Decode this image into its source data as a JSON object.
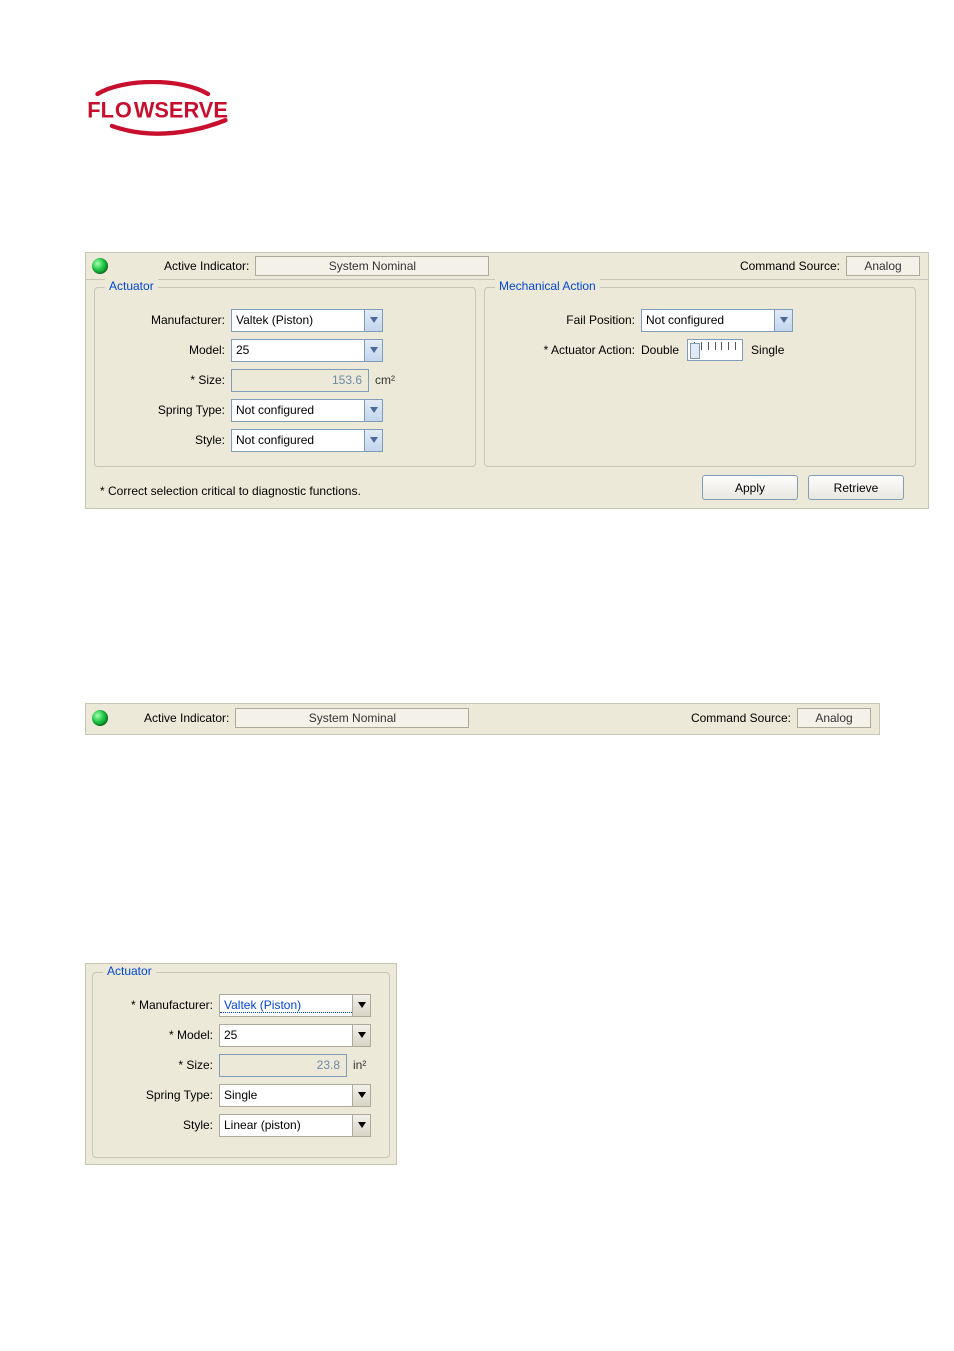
{
  "logo_text": "FLOWSERVE",
  "panel1": {
    "status": {
      "active_indicator_label": "Active Indicator:",
      "active_indicator_value": "System Nominal",
      "command_source_label": "Command Source:",
      "command_source_value": "Analog"
    },
    "actuator": {
      "legend": "Actuator",
      "manufacturer_label": "Manufacturer:",
      "manufacturer_value": "Valtek (Piston)",
      "model_label": "Model:",
      "model_value": "25",
      "size_label": "* Size:",
      "size_value": "153.6",
      "size_unit": "cm²",
      "spring_type_label": "Spring Type:",
      "spring_type_value": "Not configured",
      "style_label": "Style:",
      "style_value": "Not configured"
    },
    "mechanical": {
      "legend": "Mechanical Action",
      "fail_position_label": "Fail Position:",
      "fail_position_value": "Not configured",
      "actuator_action_label": "* Actuator Action:",
      "double_label": "Double",
      "single_label": "Single"
    },
    "note": "* Correct selection critical to diagnostic functions.",
    "apply_label": "Apply",
    "retrieve_label": "Retrieve"
  },
  "panel2": {
    "active_indicator_label": "Active Indicator:",
    "active_indicator_value": "System Nominal",
    "command_source_label": "Command Source:",
    "command_source_value": "Analog"
  },
  "panel3": {
    "legend": "Actuator",
    "manufacturer_label": "* Manufacturer:",
    "manufacturer_value": "Valtek (Piston)",
    "model_label": "* Model:",
    "model_value": "25",
    "size_label": "* Size:",
    "size_value": "23.8",
    "size_unit": "in²",
    "spring_type_label": "Spring Type:",
    "spring_type_value": "Single",
    "style_label": "Style:",
    "style_value": "Linear (piston)"
  }
}
